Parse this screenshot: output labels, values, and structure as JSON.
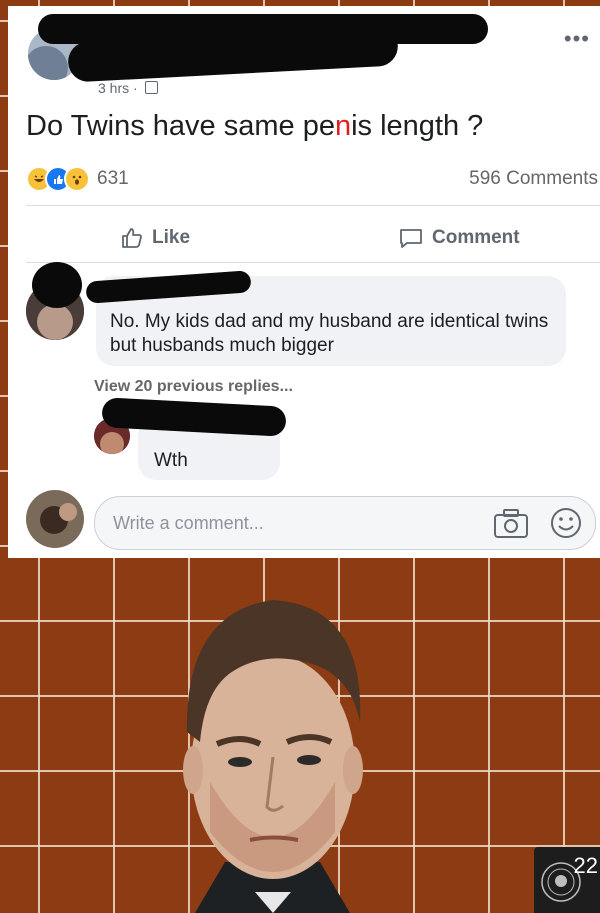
{
  "post": {
    "meta": "3 hrs ·",
    "text_prefix": "Do Twins have same pe",
    "text_mid": "n",
    "text_suffix": "is length ?",
    "reaction_count": "631",
    "comment_count": "596 Comments",
    "more_label": "•••"
  },
  "actions": {
    "like": "Like",
    "comment": "Comment"
  },
  "comments": {
    "first": {
      "text": "No. My kids dad and my husband are identical twins but husbands much bigger"
    },
    "view_previous": "View 20 previous replies...",
    "reply": {
      "text": "Wth"
    }
  },
  "composer": {
    "placeholder": "Write a comment..."
  },
  "badge": {
    "number": "22"
  },
  "colors": {
    "accent": "#1877f2",
    "backdrop": "#8c3b12"
  },
  "icons": [
    "like-icon",
    "comment-icon",
    "camera-icon",
    "emoji-icon",
    "globe-icon"
  ]
}
